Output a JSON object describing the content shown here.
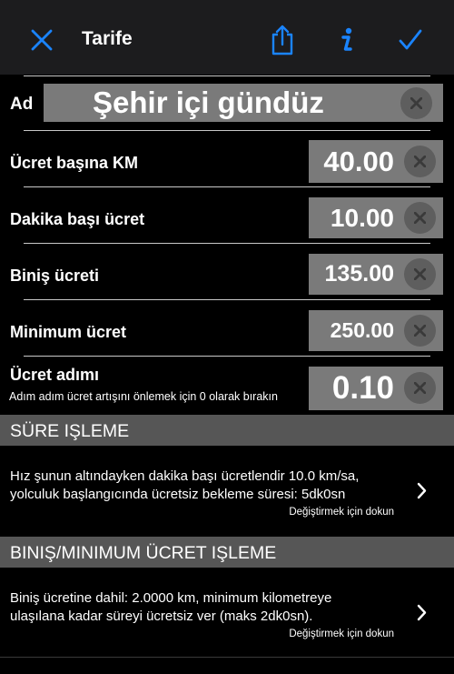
{
  "nav": {
    "title": "Tarife",
    "icons": [
      "close-icon",
      "share-icon",
      "info-icon",
      "checkmark-icon"
    ],
    "accent_color": "#1a84ff"
  },
  "name_row": {
    "label": "Ad",
    "value": "Şehir içi gündüz"
  },
  "rows": [
    {
      "label": "Ücret başına KM",
      "value": "40.00"
    },
    {
      "label": "Dakika başı ücret",
      "value": "10.00"
    },
    {
      "label": "Biniş ücreti",
      "value": "135.00"
    },
    {
      "label": "Minimum ücret",
      "value": "250.00"
    },
    {
      "label": "Ücret adımı",
      "value": "0.10",
      "hint": "Adım adım ücret artışını önlemek için 0 olarak bırakın"
    }
  ],
  "sections": [
    {
      "title": "SÜRE IŞLEME",
      "line1": "Hız şunun altındayken dakika başı ücretlendir 10.0 km/sa,",
      "line2": "yolculuk başlangıcında ücretsiz bekleme süresi: 5dk0sn",
      "hint": "Değiştirmek için dokun"
    },
    {
      "title": "BINIŞ/MINIMUM ÜCRET IŞLEME",
      "line1": "Biniş ücretine dahil: 2.0000 km, minimum kilometreye",
      "line2": "ulaşılana kadar süreyi ücretsiz ver (maks 2dk0sn).",
      "hint": "Değiştirmek için dokun"
    }
  ]
}
